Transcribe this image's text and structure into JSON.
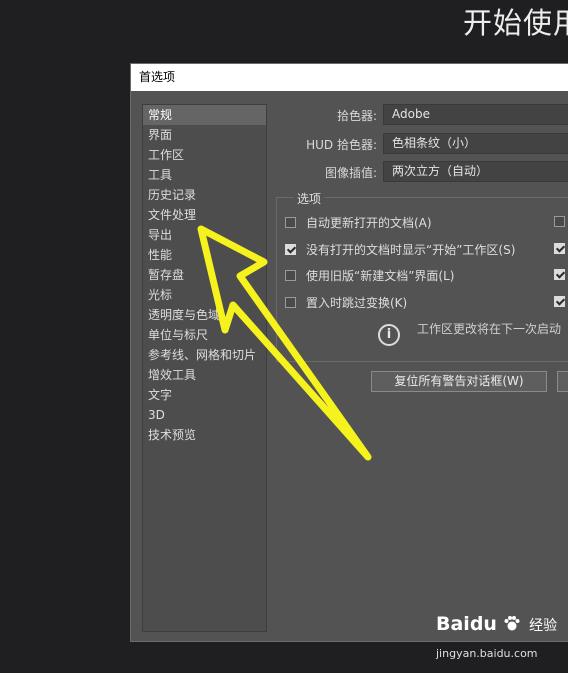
{
  "background": {
    "title": "开始使用"
  },
  "dialog": {
    "title": "首选项",
    "nav": [
      {
        "label": "常规",
        "selected": true
      },
      {
        "label": "界面"
      },
      {
        "label": "工作区"
      },
      {
        "label": "工具"
      },
      {
        "label": "历史记录"
      },
      {
        "label": "文件处理"
      },
      {
        "label": "导出"
      },
      {
        "label": "性能"
      },
      {
        "label": "暂存盘"
      },
      {
        "label": "光标"
      },
      {
        "label": "透明度与色域"
      },
      {
        "label": "单位与标尺"
      },
      {
        "label": "参考线、网格和切片"
      },
      {
        "label": "增效工具"
      },
      {
        "label": "文字"
      },
      {
        "label": "3D"
      },
      {
        "label": "技术预览"
      }
    ],
    "fields": {
      "color_picker_label": "拾色器:",
      "color_picker_value": "Adobe",
      "hud_label": "HUD 拾色器:",
      "hud_value": "色相条纹（小）",
      "interp_label": "图像插值:",
      "interp_value": "两次立方（自动）"
    },
    "options": {
      "title": "选项",
      "items": [
        {
          "label": "自动更新打开的文档(A)",
          "checked": false
        },
        {
          "label": "没有打开的文档时显示“开始”工作区(S)",
          "checked": true
        },
        {
          "label": "使用旧版“新建文档”界面(L)",
          "checked": false
        },
        {
          "label": "置入时跳过变换(K)",
          "checked": false
        }
      ],
      "right_column_checked": [
        false,
        true,
        true,
        true
      ],
      "info_text": "工作区更改将在下一次启动"
    },
    "reset_button": "复位所有警告对话框(W)",
    "info_icon": "info-icon"
  },
  "annotation": {
    "color": "#f6f21e",
    "icon": "arrow-annotation"
  },
  "watermark": {
    "logo": "Baidu",
    "cn": "经验",
    "url": "jingyan.baidu.com"
  }
}
